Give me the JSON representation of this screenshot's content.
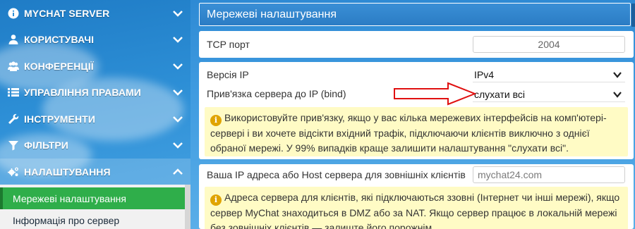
{
  "sidebar": {
    "items": [
      {
        "label": "MYCHAT SERVER",
        "icon": "info-icon",
        "expanded": false
      },
      {
        "label": "КОРИСТУВАЧІ",
        "icon": "users-icon",
        "expanded": false
      },
      {
        "label": "КОНФЕРЕНЦІЇ",
        "icon": "users-group-icon",
        "expanded": false
      },
      {
        "label": "УПРАВЛІННЯ ПРАВАМИ",
        "icon": "list-icon",
        "expanded": false
      },
      {
        "label": "ІНСТРУМЕНТИ",
        "icon": "wrench-icon",
        "expanded": false
      },
      {
        "label": "ФІЛЬТРИ",
        "icon": "filter-icon",
        "expanded": false
      },
      {
        "label": "НАЛАШТУВАННЯ",
        "icon": "gears-icon",
        "expanded": true
      }
    ],
    "subitems": [
      {
        "label": "Мережеві налаштування",
        "current": true
      },
      {
        "label": "Інформація про сервер",
        "current": false
      }
    ]
  },
  "main": {
    "title": "Мережеві налаштування",
    "tcp": {
      "label": "TCP порт",
      "value": "2004"
    },
    "ip_version": {
      "label": "Версія IP",
      "value": "IPv4"
    },
    "bind": {
      "label": "Прив'язка сервера до IP (bind)",
      "value": "слухати всі"
    },
    "bind_note": "Використовуйте прив'язку, якщо у вас кілька мережевих інтерфейсів на комп'ютері-сервері і ви хочете відсікти вхідний трафік, підключаючи клієнтів виключно з однієї обраної мережі. У 99% випадків краще залишити налаштування \"слухати всі\".",
    "external": {
      "label": "Ваша IP адреса або Host сервера для зовнішніх клієнтів",
      "placeholder": "mychat24.com"
    },
    "external_note": "Адреса сервера для клієнтів, які підключаються ззовні (Інтернет чи інші мережі), якщо сервер MyChat знаходиться в DMZ або за NAT. Якщо сервер працює в локальній мережі без зовнішніх клієнтів — залиште його порожнім."
  },
  "colors": {
    "accent": "#2b7cc4",
    "active_sub": "#2fae4a",
    "note_bg": "#fffbc5",
    "arrow": "#e01010"
  }
}
